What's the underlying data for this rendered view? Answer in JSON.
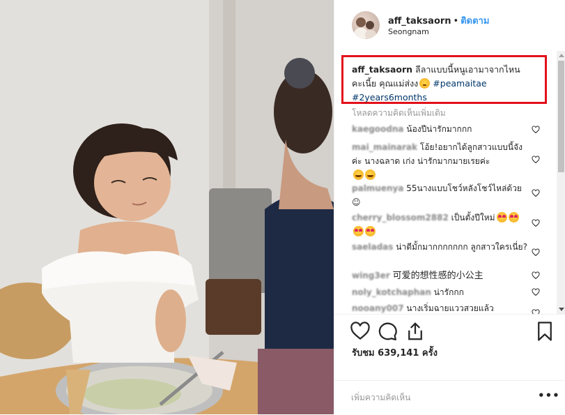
{
  "header": {
    "username": "aff_taksaorn",
    "separator": "•",
    "follow_label": "ติดตาม",
    "location": "Seongnam"
  },
  "caption": {
    "username": "aff_taksaorn",
    "text": "ลีลาแบบนี้หนูเอามาจากไหนคะเนี้ย คุณแม่ส่งง",
    "emoji": "sweat-smile-emoji",
    "hashtag1": "#peamaitae",
    "hashtag2": "#2years6months"
  },
  "load_more_label": "โหลดความคิดเห็นเพิ่มเติม",
  "comments": [
    {
      "username": "kaegoodna",
      "text": "น้องปีน่ารักมากกก"
    },
    {
      "username": "mai_mainarak",
      "text": "โอ้ย!อยากได้ลูกสาวแบบนี้จังค่ะ นางฉลาด เก่ง น่ารักมากมายเรยค่ะ",
      "emoji": "grin-emoji"
    },
    {
      "username": "palmuenya",
      "text": "55นางแบบโชว์หลังโชว์ไหล่ด้วย ☺"
    },
    {
      "username": "cherry_blossom2882",
      "text": "เป็นตั้งปีใหม่",
      "emoji": "heart-eyes-emoji"
    },
    {
      "username": "saeladas",
      "text": "น่าตีมั้กมากกกกกกก ลูกสาวใครเนี่ย?"
    },
    {
      "username": "wing3er",
      "text": "可爱的想性感的小公主"
    },
    {
      "username": "noly_kotchaphan",
      "text": "น่ารักกก"
    },
    {
      "username": "nooany007",
      "text": "นางเริ่มฉายแววสวยแล้ว"
    }
  ],
  "icons": {
    "like": "heart-icon",
    "comment": "comment-icon",
    "share": "share-icon",
    "save": "bookmark-icon",
    "comment_like": "heart-outline-icon",
    "more": "more-dots-icon"
  },
  "views_text": "รับชม 639,141 ครั้ง",
  "add_comment_placeholder": "เพิ่มความคิดเห็น",
  "more_label": "•••",
  "colors": {
    "highlight_border": "#e3101a",
    "follow_blue": "#3897f0",
    "hashtag": "#003569"
  }
}
